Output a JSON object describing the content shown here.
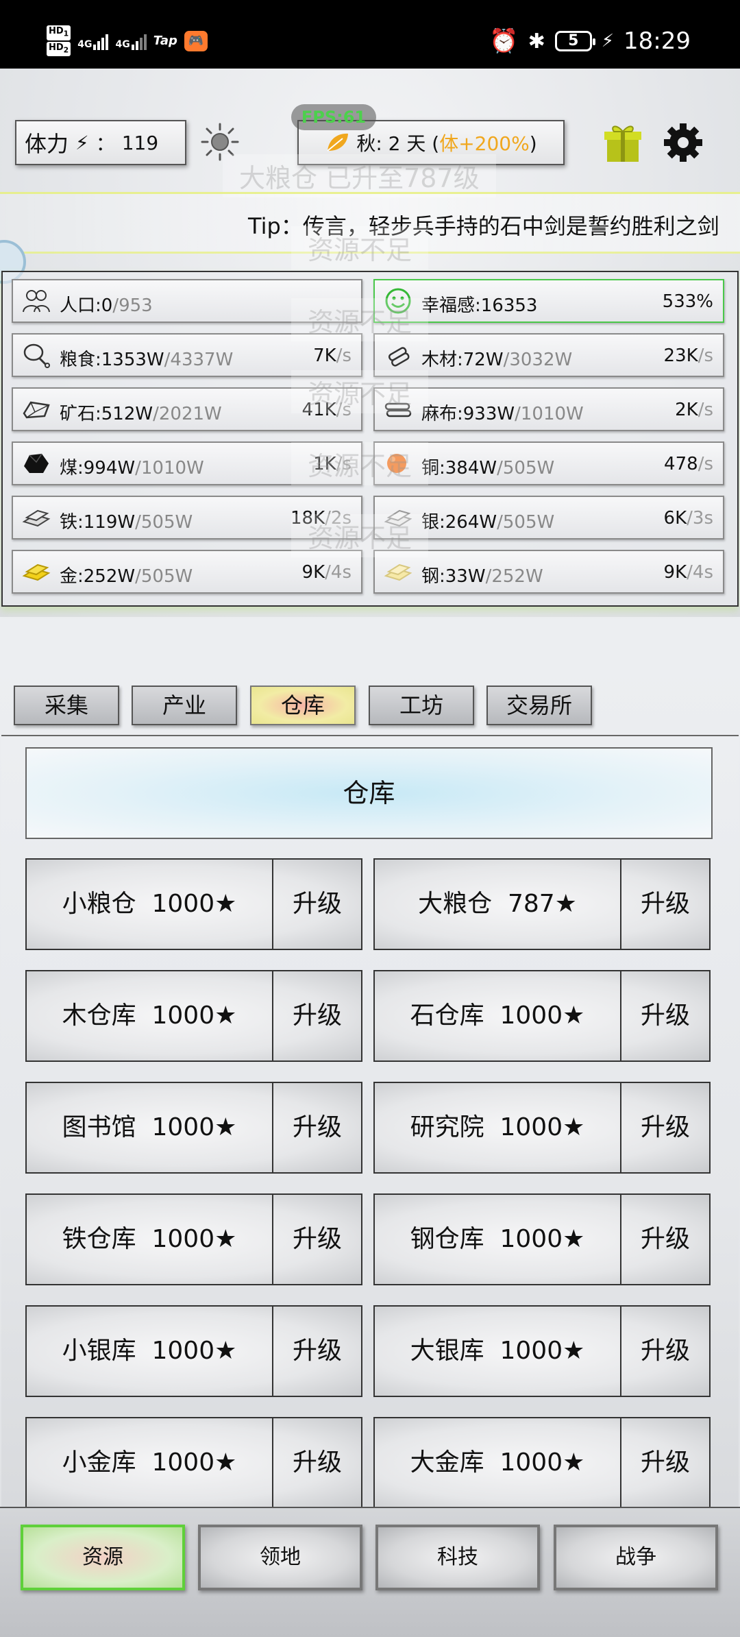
{
  "status_bar": {
    "hd1": "HD",
    "hd1_sub": "1",
    "hd2": "HD",
    "hd2_sub": "2",
    "net1": "4G",
    "net2": "4G",
    "tap_label": "Tap",
    "battery": "5",
    "time": "18:29"
  },
  "header": {
    "stamina_label": "体力",
    "stamina_sep": "：",
    "stamina_value": "119",
    "season_text": "秋: 2 天 (",
    "season_bonus": "体+200%",
    "season_close": ")",
    "fps": "FPS:61",
    "ghost_notice": "大粮仓 已升至787级",
    "ghost_resource": "资源不足",
    "tip": "Tip：传言，轻步兵手持的石中剑是誓约胜利之剑"
  },
  "resources": [
    {
      "name": "人口:0",
      "cap": "/953",
      "rate": "",
      "unit": "",
      "icon": "people-icon"
    },
    {
      "name": "幸福感:16353",
      "cap": "",
      "rate": "533%",
      "unit": "",
      "icon": "smile-icon"
    },
    {
      "name": "粮食:1353W",
      "cap": "/4337W",
      "rate": "7K",
      "unit": "/s",
      "icon": "meat-icon"
    },
    {
      "name": "木材:72W",
      "cap": "/3032W",
      "rate": "23K",
      "unit": "/s",
      "icon": "wood-icon"
    },
    {
      "name": "矿石:512W",
      "cap": "/2021W",
      "rate": "41K",
      "unit": "/s",
      "icon": "ore-icon"
    },
    {
      "name": "麻布:933W",
      "cap": "/1010W",
      "rate": "2K",
      "unit": "/s",
      "icon": "cloth-icon"
    },
    {
      "name": "煤:994W",
      "cap": "/1010W",
      "rate": "1K",
      "unit": "/s",
      "icon": "coal-icon"
    },
    {
      "name": "铜:384W",
      "cap": "/505W",
      "rate": "478",
      "unit": "/s",
      "icon": "copper-icon"
    },
    {
      "name": "铁:119W",
      "cap": "/505W",
      "rate": "18K",
      "unit": "/2s",
      "icon": "iron-icon"
    },
    {
      "name": "银:264W",
      "cap": "/505W",
      "rate": "6K",
      "unit": "/3s",
      "icon": "silver-icon"
    },
    {
      "name": "金:252W",
      "cap": "/505W",
      "rate": "9K",
      "unit": "/4s",
      "icon": "gold-icon"
    },
    {
      "name": "钢:33W",
      "cap": "/252W",
      "rate": "9K",
      "unit": "/4s",
      "icon": "steel-icon"
    }
  ],
  "tabs": [
    "采集",
    "产业",
    "仓库",
    "工坊",
    "交易所"
  ],
  "active_tab": "仓库",
  "warehouse": {
    "title": "仓库",
    "upgrade_label": "升级",
    "buildings": [
      "小粮仓  1000★",
      "大粮仓  787★",
      "木仓库  1000★",
      "石仓库  1000★",
      "图书馆  1000★",
      "研究院  1000★",
      "铁仓库  1000★",
      "钢仓库  1000★",
      "小银库  1000★",
      "大银库  1000★",
      "小金库  1000★",
      "大金库  1000★"
    ]
  },
  "bottom_nav": [
    "资源",
    "领地",
    "科技",
    "战争"
  ],
  "colors": {
    "accent_yellow": "#f0a71e",
    "active_green": "#5fd03a",
    "fps_green": "#4cd04c"
  }
}
